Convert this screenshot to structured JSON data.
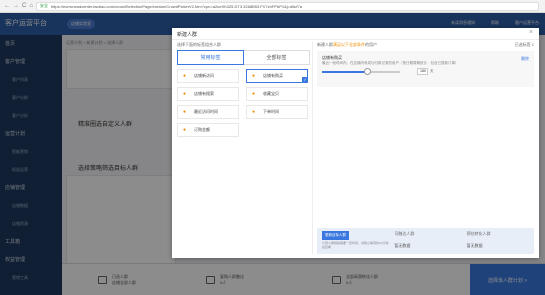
{
  "browser": {
    "nav_back": "←",
    "nav_forward": "→",
    "nav_reload": "C",
    "nav_home": "⌂",
    "secure_label": "安全",
    "url": "https://ecmcrowdcenter.taobao.com/crowdSelectionPage/creator/CrowdPickerV2.htm?cpn=a2ueXh3Z5.DT3.3268B53.FV7zhFPbP1&j=d8cf7a"
  },
  "app": {
    "brand": "客户运营平台",
    "tag": "店铺实验室",
    "topbar_right": [
      "未读消息通知",
      "帮助",
      "客户运营平台"
    ],
    "sidebar": [
      {
        "label": "首页",
        "sub": false
      },
      {
        "label": "客户管理",
        "sub": false
      },
      {
        "label": "客户列表",
        "sub": true
      },
      {
        "label": "客户分群",
        "sub": true
      },
      {
        "label": "客户分析",
        "sub": true
      },
      {
        "label": "运营计划",
        "sub": false
      },
      {
        "label": "智能营销",
        "sub": true
      },
      {
        "label": "权益运营",
        "sub": true
      },
      {
        "label": "店铺管理",
        "sub": false
      },
      {
        "label": "店铺数据",
        "sub": true
      },
      {
        "label": "店铺资源",
        "sub": true
      },
      {
        "label": "工具箱",
        "sub": false
      },
      {
        "label": "权益管理",
        "sub": false
      },
      {
        "label": "营销工具",
        "sub": true
      }
    ],
    "crumb": "运营计划 > 新建计划 > 选择人群",
    "section1": "精准圈选自定义人群",
    "section2": "选择策略筛选目标人群",
    "bottom": {
      "item1": "已选人群",
      "item1_sub": "店铺全部人群",
      "item2": "复购人群触达",
      "item2_sub": "0人",
      "item3": "全部高潜转化人群",
      "item3_sub": "0人",
      "next": "选择该人群计划 >"
    }
  },
  "modal": {
    "title": "新建人群",
    "close": "×",
    "left_hint": "选择下面的标签组合人群",
    "tabs": [
      "常用标签",
      "全部标签"
    ],
    "options": [
      {
        "label": "店铺新访问",
        "selected": false
      },
      {
        "label": "店铺有购买",
        "selected": true
      },
      {
        "label": "店铺有搜索",
        "selected": false
      },
      {
        "label": "收藏宝贝",
        "selected": false
      },
      {
        "label": "最近访问时间",
        "selected": false
      },
      {
        "label": "下单时间",
        "selected": false
      },
      {
        "label": "订购金额",
        "selected": false
      }
    ],
    "right_hint_prefix": "新建人群",
    "right_hint_highlight": "满足以下全部条件",
    "right_hint_suffix": "的用户",
    "right_count": "已选标签 1",
    "rule": {
      "name": "店铺有购买",
      "desc": "最近一段时间内，在店铺内有成功付款记录的用户（按日期周期统计，包含已退款订单）",
      "delete": "删除",
      "value": "180",
      "unit": "天",
      "slider_level": 0.58
    },
    "summary": {
      "button": "更新目标人群",
      "note": "计算人群规模需要一定时间，请耐心等待约10分钟后查看",
      "col2_label": "可触达人群",
      "col2_value": "暂无数据",
      "col3_label": "预估转化人群",
      "col3_value": "暂无数据"
    }
  }
}
